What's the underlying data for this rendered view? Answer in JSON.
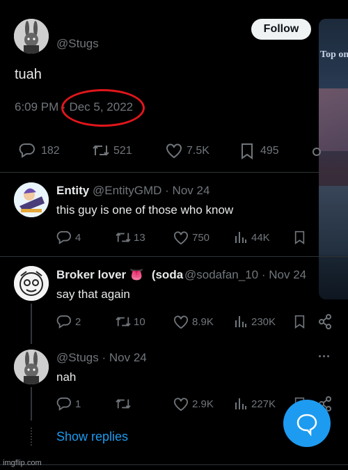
{
  "tweet": {
    "handle": "@Stugs",
    "follow_label": "Follow",
    "text": "tuah",
    "time": "6:09 PM",
    "date_sep": "·",
    "date": "Dec 5, 2022",
    "reply_count": "182",
    "retweet_count": "521",
    "like_count": "7.5K",
    "bookmark_count": "495",
    "media_text": "Top one",
    "annotation_color": "#e0161b"
  },
  "replies": [
    {
      "name": "Entity",
      "handle": "@EntityGMD",
      "sep": "·",
      "date": "Nov 24",
      "text": "this guy is one of those who know",
      "reply_count": "4",
      "retweet_count": "13",
      "like_count": "750",
      "view_count": "44K"
    },
    {
      "name": "Broker lover",
      "name_emoji": "👅",
      "name_trunc": "(soda",
      "handle": "@sodafan_10",
      "sep": "·",
      "date": "Nov 24",
      "text": "say that again",
      "reply_count": "2",
      "retweet_count": "10",
      "like_count": "8.9K",
      "view_count": "230K"
    },
    {
      "name": "",
      "handle": "@Stugs",
      "sep": "·",
      "date": "Nov 24",
      "text": "nah",
      "reply_count": "1",
      "retweet_count": "",
      "like_count": "2.9K",
      "view_count": "227K",
      "more": "···"
    }
  ],
  "show_replies_label": "Show replies",
  "watermark": "imgflip.com",
  "colors": {
    "accent": "#1d9bf0",
    "background": "#000000",
    "text_secondary": "#71767b"
  }
}
